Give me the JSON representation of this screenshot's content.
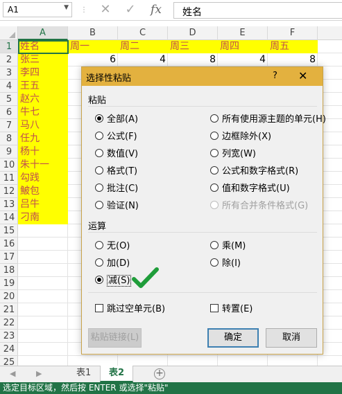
{
  "formula_bar": {
    "name_box": "A1",
    "formula_text": "姓名",
    "cancel_icon": "✕",
    "enter_icon": "✓",
    "fx_label": "fx"
  },
  "columns": [
    "A",
    "B",
    "C",
    "D",
    "E",
    "F"
  ],
  "rows": [
    "1",
    "2",
    "3",
    "4",
    "5",
    "6",
    "7",
    "8",
    "9",
    "10",
    "11",
    "12",
    "13",
    "14",
    "15",
    "16",
    "17",
    "18",
    "19",
    "20",
    "21",
    "22",
    "23",
    "24",
    "25"
  ],
  "sheet": {
    "header_A": "姓名",
    "names": [
      "张三",
      "李四",
      "王五",
      "赵六",
      "牛七",
      "马八",
      "任九",
      "杨十",
      "朱十一",
      "勾践",
      "鮍包",
      "吕牛",
      "刁南"
    ],
    "weekdays": [
      "周一",
      "周二",
      "周三",
      "周四",
      "周五"
    ],
    "row2_values": [
      "6",
      "4",
      "8",
      "4",
      "8"
    ]
  },
  "tabs": [
    "表1",
    "表2"
  ],
  "active_tab": "表2",
  "status": "选定目标区域，然后按 ENTER 或选择\"粘贴\"",
  "dialog": {
    "title": "选择性粘贴",
    "help": "?",
    "close": "✕",
    "paste_label": "粘贴",
    "paste_options": {
      "all": "全部(A)",
      "formulas": "公式(F)",
      "values": "数值(V)",
      "formats": "格式(T)",
      "comments": "批注(C)",
      "validation": "验证(N)",
      "all_source_theme": "所有使用源主题的单元(H)",
      "all_except_borders": "边框除外(X)",
      "column_widths": "列宽(W)",
      "formulas_number_formats": "公式和数字格式(R)",
      "values_number_formats": "值和数字格式(U)",
      "all_merging_cond_formats": "所有合并条件格式(G)"
    },
    "operation_label": "运算",
    "operations": {
      "none": "无(O)",
      "add": "加(D)",
      "subtract": "减(S)",
      "multiply": "乘(M)",
      "divide": "除(I)"
    },
    "skip_blanks": "跳过空单元(B)",
    "transpose": "转置(E)",
    "paste_link": "粘贴链接(L)",
    "ok": "确定",
    "cancel": "取消"
  },
  "colors": {
    "accent": "#217346",
    "highlight": "#ffff00",
    "title_bar": "#e3b13f",
    "text_red": "#c0504d"
  }
}
